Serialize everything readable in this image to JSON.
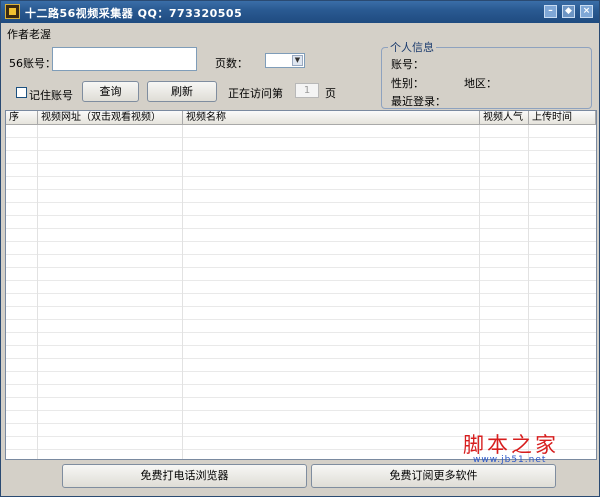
{
  "window": {
    "title": "十二路56视频采集器 QQ：773320505"
  },
  "author": "作者老渥",
  "form": {
    "account_label": "56账号：",
    "account_value": "",
    "pages_label": "页数：",
    "pages_value": "",
    "remember_label": "记住账号",
    "remember_checked": false,
    "query_button": "查询",
    "refresh_button": "刷新",
    "visiting_label": "正在访问第",
    "visiting_page": "1",
    "page_suffix": "页"
  },
  "personal_info": {
    "legend": "个人信息",
    "account_label": "账号：",
    "gender_label": "性别：",
    "region_label": "地区：",
    "last_login_label": "最近登录："
  },
  "table": {
    "columns": [
      "序",
      "视频网址（双击观看视频）",
      "视频名称",
      "视频人气",
      "上传时间"
    ],
    "rows": []
  },
  "footer": {
    "browser_button": "免费打电话浏览器",
    "subscribe_button": "免费订阅更多软件"
  },
  "watermark": {
    "title": "脚本之家",
    "url": "www.jb51.net"
  },
  "colors": {
    "titlebar": "#2a5a92",
    "window_bg": "#d4d0c8",
    "watermark_red": "#d71e1e"
  }
}
